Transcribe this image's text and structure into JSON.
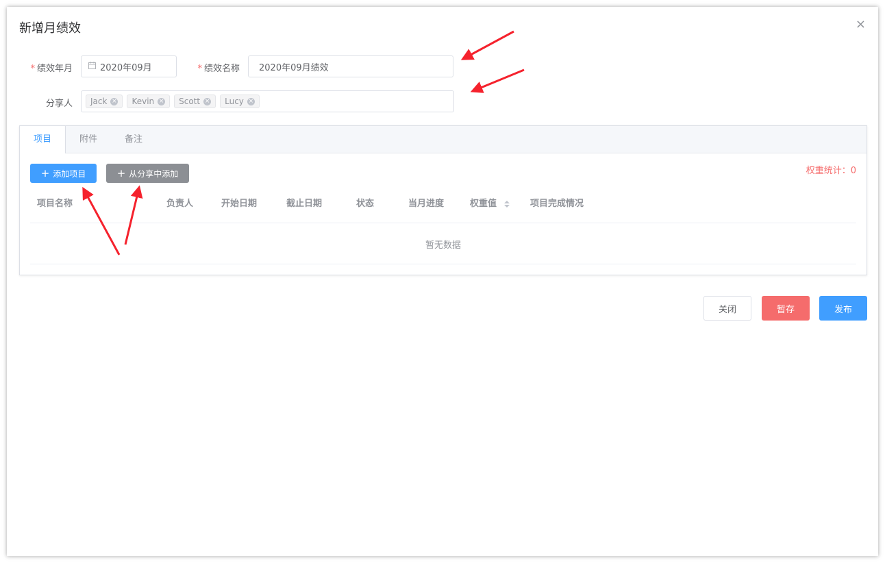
{
  "dialog": {
    "title": "新增月绩效",
    "close_icon": "×"
  },
  "form": {
    "month": {
      "required_mark": "*",
      "label": "绩效年月",
      "value": "2020年09月",
      "icon": "calendar-icon"
    },
    "name": {
      "required_mark": "*",
      "label": "绩效名称",
      "value": "2020年09月绩效"
    },
    "share": {
      "label": "分享人",
      "tags": [
        "Jack",
        "Kevin",
        "Scott",
        "Lucy"
      ]
    }
  },
  "tabs": [
    "项目",
    "附件",
    "备注"
  ],
  "toolbar": {
    "add_project": "添加项目",
    "add_from_share": "从分享中添加",
    "plus_icon": "+"
  },
  "weight_total": "权重统计：0",
  "table": {
    "columns": [
      "项目名称",
      "负责人",
      "开始日期",
      "截止日期",
      "状态",
      "当月进度",
      "权重值",
      "项目完成情况"
    ],
    "empty_text": "暂无数据"
  },
  "footer": {
    "close": "关闭",
    "save_draft": "暂存",
    "publish": "发布"
  },
  "colors": {
    "primary": "#409eff",
    "danger": "#f56c6c",
    "annotation_arrow": "#f5222d"
  }
}
